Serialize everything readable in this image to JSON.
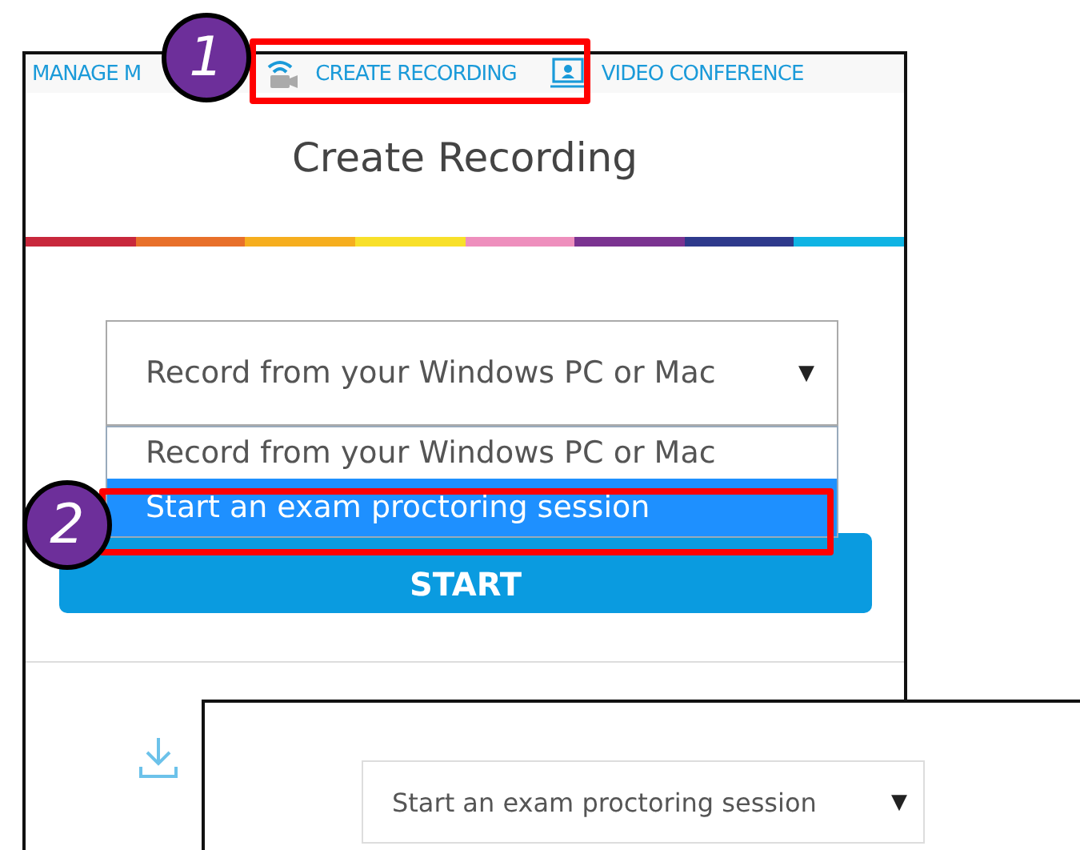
{
  "nav": [
    {
      "label": "MANAGE M",
      "kind": "text"
    },
    {
      "label": "CREATE RECORDING",
      "kind": "camera"
    },
    {
      "label": "VIDEO CONFERENCE",
      "kind": "monitor"
    }
  ],
  "dialog": {
    "title": "Create Recording",
    "select": {
      "value": "Record from your Windows PC or Mac",
      "arrow": "▼"
    },
    "options": [
      {
        "label": "Record from your Windows PC or Mac",
        "selected": false
      },
      {
        "label": "Start an exam proctoring session",
        "selected": true
      }
    ],
    "start": "START"
  },
  "inset": {
    "value": "Start an exam proctoring session",
    "arrow": "▼"
  },
  "callouts": [
    {
      "number": "1"
    },
    {
      "number": "2"
    }
  ]
}
